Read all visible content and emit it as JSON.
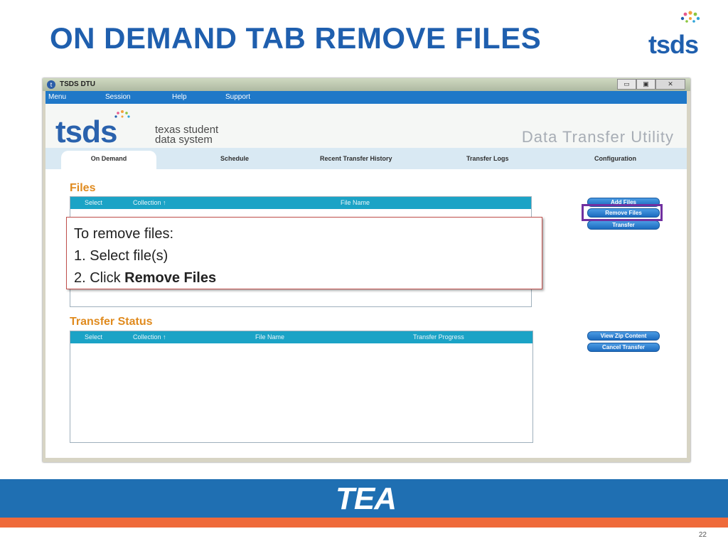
{
  "slide": {
    "title": "ON DEMAND TAB REMOVE FILES",
    "logo_text": "tsds",
    "page_number": "22",
    "footer_logo_text": "TEA"
  },
  "window": {
    "title": "TSDS DTU",
    "controls": [
      "▭",
      "▣",
      "✕"
    ],
    "menu": [
      "Menu",
      "Session",
      "Help",
      "Support"
    ]
  },
  "app": {
    "logo_text": "tsds",
    "logo_subtitle": [
      "texas student",
      "data system"
    ],
    "product_name": "Data Transfer Utility",
    "tabs": [
      "On Demand",
      "Schedule",
      "Recent Transfer History",
      "Transfer Logs",
      "Configuration"
    ],
    "files": {
      "title": "Files",
      "columns": [
        "Select",
        "Collection ↑",
        "File Name"
      ],
      "buttons": [
        "Add Files",
        "Remove Files",
        "Transfer"
      ]
    },
    "transfer_status": {
      "title": "Transfer Status",
      "columns": [
        "Select",
        "Collection ↑",
        "File Name",
        "Transfer Progress"
      ],
      "buttons": [
        "View Zip Content",
        "Cancel Transfer"
      ]
    }
  },
  "callout": {
    "line1": "To remove files:",
    "line2": "1. Select file(s)",
    "line3_prefix": "2. Click ",
    "line3_bold": "Remove Files"
  },
  "colors": {
    "title_blue": "#1f5fae",
    "menu_blue": "#1f78c8",
    "grid_header": "#1ba3c6",
    "section_orange": "#e08b1f",
    "highlight_purple": "#7030a0",
    "footer_blue": "#1f6fb2",
    "footer_orange": "#ef6a3a"
  }
}
